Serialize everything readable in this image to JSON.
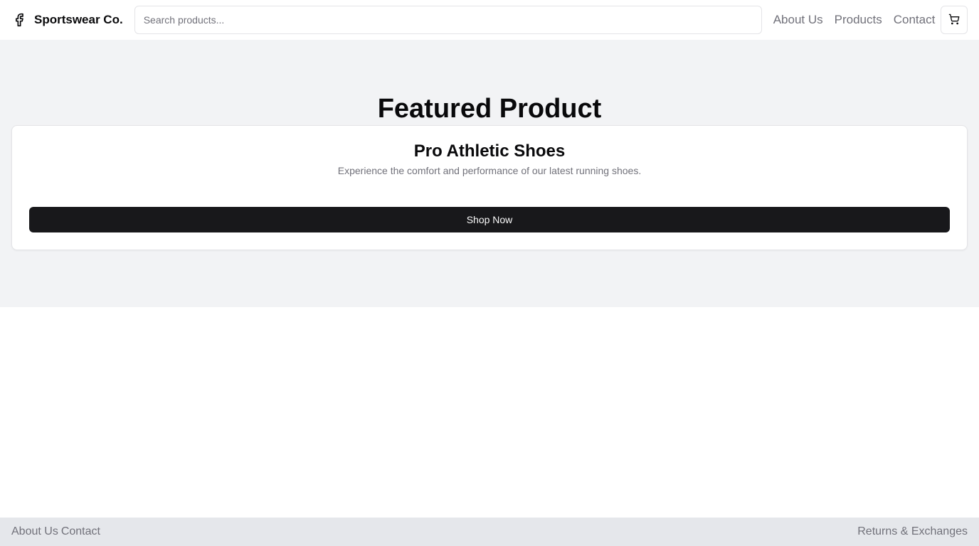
{
  "header": {
    "brand": "Sportswear Co.",
    "search_placeholder": "Search products...",
    "nav": [
      "About Us",
      "Products",
      "Contact"
    ],
    "cart_icon": "cart-icon",
    "brand_icon": "facebook-f-icon"
  },
  "hero": {
    "title": "Featured Product",
    "product": {
      "name": "Pro Athletic Shoes",
      "description": "Experience the comfort and performance of our latest running shoes.",
      "cta": "Shop Now"
    }
  },
  "footer": {
    "left_links": [
      "About Us",
      "Contact"
    ],
    "right_link": "Returns & Exchanges"
  },
  "colors": {
    "primary": "#18181b",
    "muted_text": "#71717a",
    "hero_bg": "#f2f3f5",
    "footer_bg": "#e5e7eb",
    "border": "#e4e4e7"
  }
}
